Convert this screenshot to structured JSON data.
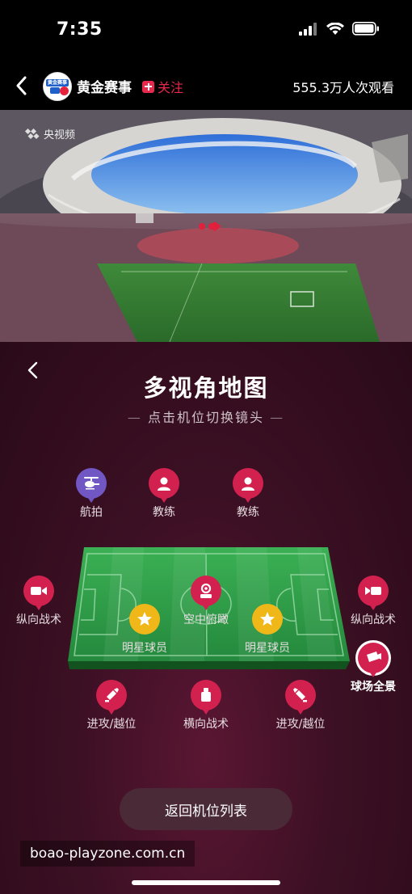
{
  "status": {
    "time": "7:35"
  },
  "header": {
    "channel": "黄金赛事",
    "follow": "关注",
    "viewers": "555.3万人次观看",
    "avatar_text": "黄金赛事"
  },
  "video": {
    "watermark": "央视频"
  },
  "panel": {
    "title": "多视角地图",
    "subtitle": "点击机位切换镜头",
    "dash": "—",
    "cameras": {
      "aerial": "航拍",
      "coach_left": "教练",
      "coach_right": "教练",
      "vertical_left": "纵向战术",
      "vertical_right": "纵向战术",
      "overhead": "空中俯瞰",
      "star_left": "明星球员",
      "star_right": "明星球员",
      "panorama": "球场全景",
      "attack_left": "进攻/越位",
      "horizontal": "横向战术",
      "attack_right": "进攻/越位"
    },
    "return_button": "返回机位列表"
  },
  "site_watermark": "boao-playzone.com.cn",
  "colors": {
    "accent": "#d3214f",
    "follow": "#e8284d",
    "aerial": "#7057c4",
    "star": "#f0b719",
    "pitch": "#2fa048"
  }
}
